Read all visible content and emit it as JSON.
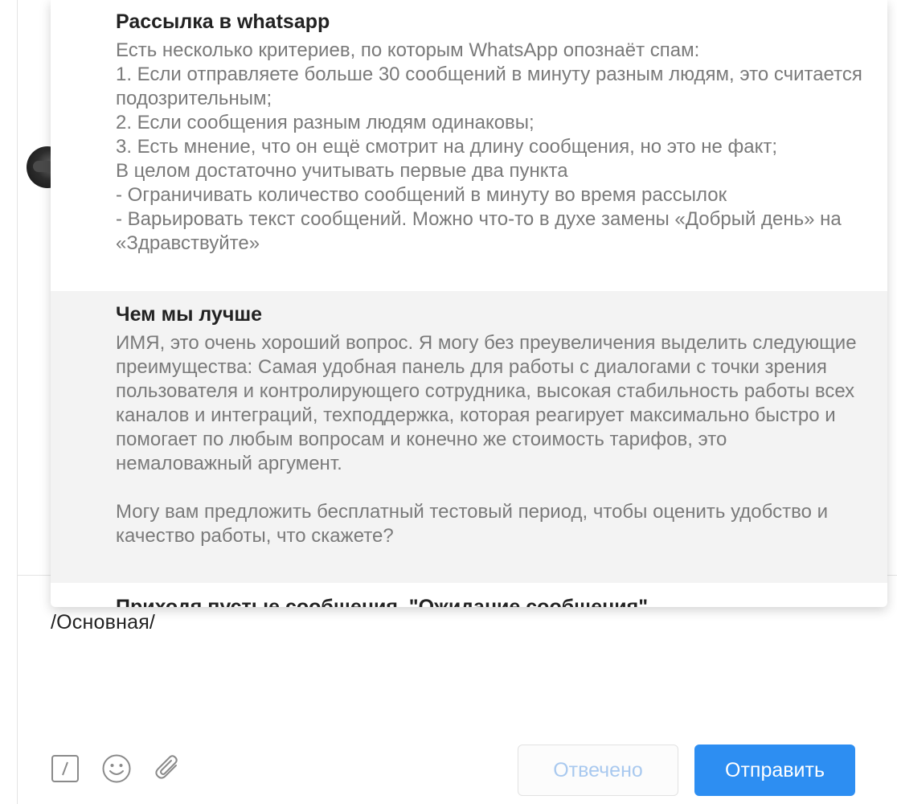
{
  "templates": [
    {
      "title": "Рассылка в whatsapp",
      "body": "Есть несколько критериев, по которым WhatsApp опознаёт спам:\n1. Если отправляете больше 30 сообщений в минуту разным людям, это считается подозрительным;\n2. Если сообщения разным людям одинаковы;\n3. Есть мнение, что он ещё смотрит на длину сообщения, но это не факт;\nВ целом достаточно учитывать первые два пункта\n- Ограничивать количество сообщений в минуту во время рассылок\n- Варьировать текст сообщений. Можно что-то в духе замены «Добрый день» на «Здравствуйте»"
    },
    {
      "title": "Чем мы лучше",
      "body": "ИМЯ, это очень хороший вопрос. Я могу без преувеличения выделить следующие преимущества: Самая удобная панель для работы с диалогами с точки зрения пользователя и контролирующего сотрудника, высокая стабильность работы всех каналов и интеграций, техподдержка, которая реагирует максимально быстро и помогает по любым вопросам и конечно же стоимость тарифов, это немаловажный аргумент.\n\nМогу вам предложить бесплатный тестовый период, чтобы оценить удобство и качество работы, что скажете?"
    },
    {
      "title": "Приходя пустые сообщения. \"Ожидание сообщения\"",
      "body": ""
    }
  ],
  "composer": {
    "value": "/Основная/"
  },
  "toolbar": {
    "templates_icon_glyph": "/",
    "emoji_icon": "smiley-icon",
    "attach_icon": "paperclip-icon"
  },
  "buttons": {
    "answered_label": "Отвечено",
    "send_label": "Отправить"
  },
  "colors": {
    "send_bg": "#2d8ef2",
    "answered_text": "#a9c9ef",
    "selected_row_bg": "#f3f3f3"
  }
}
